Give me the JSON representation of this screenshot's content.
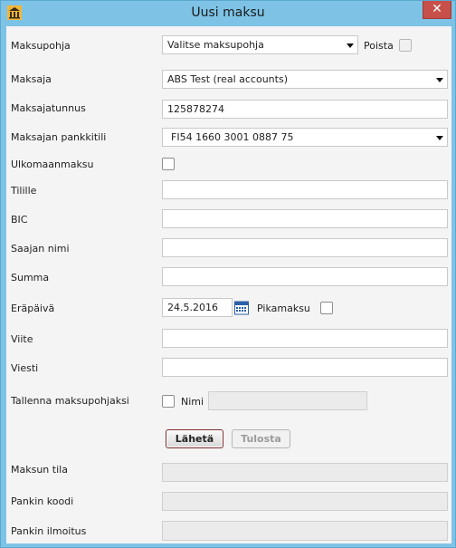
{
  "window": {
    "title": "Uusi maksu",
    "close_glyph": "✕",
    "icon": "bank-icon"
  },
  "colors": {
    "titlebar": "#7ec3e6",
    "close": "#c7504a",
    "button_border": "#7a2e2e"
  },
  "form": {
    "maksupohja": {
      "label": "Maksupohja",
      "value": "Valitse maksupohja",
      "delete_label": "Poista"
    },
    "maksaja": {
      "label": "Maksaja",
      "value": "ABS Test (real accounts)"
    },
    "maksajatunnus": {
      "label": "Maksajatunnus",
      "value": "125878274"
    },
    "pankkitili": {
      "label": "Maksajan pankkitili",
      "value": "FI54 1660 3001 0887 75"
    },
    "ulkomaanmaksu": {
      "label": "Ulkomaanmaksu"
    },
    "tilille": {
      "label": "Tilille",
      "value": ""
    },
    "bic": {
      "label": "BIC",
      "value": ""
    },
    "saajan_nimi": {
      "label": "Saajan nimi",
      "value": ""
    },
    "summa": {
      "label": "Summa",
      "value": ""
    },
    "erapaiva": {
      "label": "Eräpäivä",
      "value": "24.5.2016",
      "calendar_icon": "calendar-icon",
      "pikamaksu_label": "Pikamaksu"
    },
    "viite": {
      "label": "Viite",
      "value": ""
    },
    "viesti": {
      "label": "Viesti",
      "value": ""
    },
    "tallenna": {
      "label": "Tallenna maksupohjaksi",
      "name_label": "Nimi",
      "name_value": ""
    }
  },
  "buttons": {
    "send": "Lähetä",
    "print": "Tulosta"
  },
  "status": {
    "maksun_tila": {
      "label": "Maksun tila",
      "value": ""
    },
    "pankin_koodi": {
      "label": "Pankin koodi",
      "value": ""
    },
    "pankin_ilmoitus": {
      "label": "Pankin ilmoitus",
      "value": ""
    }
  }
}
